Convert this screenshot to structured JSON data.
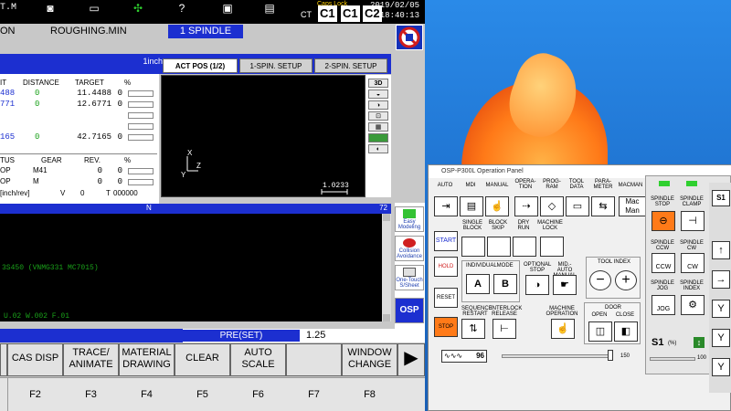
{
  "header": {
    "brand": "T.M",
    "capslock": "Caps Lock",
    "c1": "C1",
    "c2": "C2",
    "date": "2019/02/05",
    "time": "18:40:13"
  },
  "mode_row": {
    "left": "ON",
    "mode": "ROUGHING.MIN",
    "spindle": "1 SPINDLE"
  },
  "position": {
    "unit": "1inch",
    "headers": [
      "IT",
      "DISTANCE",
      "TARGET",
      "%"
    ],
    "rows": [
      {
        "actual": "488",
        "distance": "0",
        "target": "11.4488",
        "pct": "0"
      },
      {
        "actual": "771",
        "distance": "0",
        "target": "12.6771",
        "pct": "0"
      },
      {
        "actual": "165",
        "distance": "0",
        "target": "42.7165",
        "pct": "0"
      }
    ],
    "status_headers": [
      "TUS",
      "GEAR",
      "REV.",
      "%"
    ],
    "status_rows": [
      {
        "a": "OP",
        "gear": "M41",
        "rev": "0",
        "pct": "0"
      },
      {
        "a": "OP",
        "gear": "M",
        "rev": "0",
        "pct": "0"
      }
    ],
    "feed_label": "[inch/rev]",
    "v_label": "V",
    "v_val": "0",
    "t_label": "T",
    "t_val": "000000"
  },
  "tabs": [
    "ACT POS (1/2)",
    "1-SPIN. SETUP",
    "2-SPIN. SETUP"
  ],
  "graph": {
    "scale": "1.0233",
    "axis_x": "X",
    "axis_z": "Z",
    "axis_y": "Y",
    "tools": [
      "3D",
      "",
      "",
      "",
      "",
      "",
      ""
    ]
  },
  "program": {
    "head_n": "N",
    "head_num": "72",
    "line1": "3S450 (VNMG331 MC7015)",
    "line2": "U.02 W.002 F.01"
  },
  "side_buttons": [
    "Easy Modeling",
    "Collision Avoidance",
    "One-Touch S/Sheet",
    "OSP"
  ],
  "input": {
    "pre_label": "PRE(SET)",
    "value": "1.25"
  },
  "fkeys": [
    "CAS DISP",
    "TRACE/ ANIMATE",
    "MATERIAL DRAWING",
    "CLEAR",
    "AUTO SCALE",
    "",
    "WINDOW CHANGE"
  ],
  "fnums": [
    "F2",
    "F3",
    "F4",
    "F5",
    "F6",
    "F7",
    "F8"
  ],
  "op_panel": {
    "title": "OSP-P300L Operation Panel",
    "mode_labels": [
      "AUTO",
      "MDI",
      "MANUAL",
      "OPERA- TION",
      "PROG- RAM",
      "TOOL DATA",
      "PARA- METER",
      "MACMAN"
    ],
    "macman_btn": "Mac Man",
    "row2_labels": [
      "SINGLE BLOCK",
      "BLOCK SKIP",
      "DRY RUN",
      "MACHINE LOCK"
    ],
    "row2_syms": [
      "",
      "",
      "",
      ""
    ],
    "cycle_start": "START",
    "hold": "HOLD",
    "reset": "RESET",
    "stop": "STOP",
    "individual_mode": "INDIVIDUALMODE",
    "optional_stop": "OPTIONAL STOP",
    "mid_auto": "MID.-AUTO MANUAL",
    "tool_index": "TOOL INDEX",
    "seq_restart": "SEQUENCE RESTART",
    "interlock": "INTERLOCK RELEASE",
    "machine_op": "MACHINE OPERATION",
    "door": "DOOR",
    "door_open": "OPEN",
    "door_close": "CLOSE",
    "spindle_label": "S1",
    "spindle_pct": "(%)",
    "override": "96",
    "slider_max": "150",
    "right_labels": [
      "SPINDLE STOP",
      "SPINDLE CLAMP",
      "SPINDLE CCW",
      "SPINDLE CW",
      "SPINDLE JOG",
      "SPINDLE INDEX"
    ],
    "btn_ccw": "CCW",
    "btn_cw": "CW",
    "btn_jog": "JOG",
    "btn_ab": [
      "A",
      "B"
    ],
    "minus_sym": "−",
    "plus_sym": "+",
    "s100": "100",
    "s1_label": "S1"
  }
}
